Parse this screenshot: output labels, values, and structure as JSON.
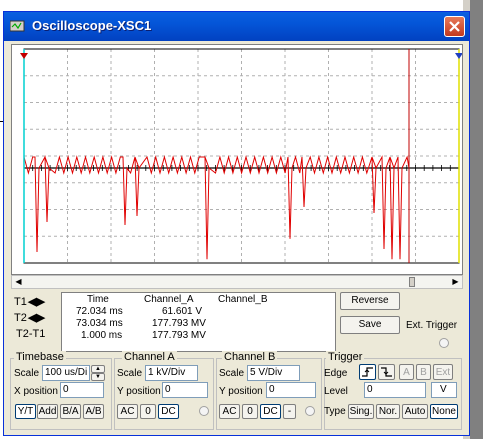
{
  "window": {
    "title": "Oscilloscope-XSC1"
  },
  "colors": {
    "trace_a": "#e00000",
    "cursor_t1": "#00d0d0",
    "cursor_t2": "#e0e000",
    "titlebar": "#0455d8"
  },
  "icons": {
    "title": "oscilloscope-icon",
    "close": "close-icon"
  },
  "readout": {
    "headers": [
      "Time",
      "Channel_A",
      "Channel_B"
    ],
    "rows": [
      {
        "label": "T1",
        "time": "72.034 ms",
        "a": "61.601 V",
        "b": ""
      },
      {
        "label": "T2",
        "time": "73.034 ms",
        "a": "177.793 MV",
        "b": ""
      },
      {
        "label": "T2-T1",
        "time": "1.000 ms",
        "a": "177.793 MV",
        "b": ""
      }
    ]
  },
  "buttons": {
    "reverse": "Reverse",
    "save": "Save"
  },
  "ext_trigger": "Ext. Trigger",
  "timebase": {
    "title": "Timebase",
    "scale_label": "Scale",
    "scale_value": "100 us/Di",
    "xpos_label": "X position",
    "xpos_value": "0",
    "modes": [
      "Y/T",
      "Add",
      "B/A",
      "A/B"
    ]
  },
  "channel_a": {
    "title": "Channel A",
    "scale_label": "Scale",
    "scale_value": "1 kV/Div",
    "ypos_label": "Y position",
    "ypos_value": "0",
    "coupling": [
      "AC",
      "0",
      "DC"
    ]
  },
  "channel_b": {
    "title": "Channel B",
    "scale_label": "Scale",
    "scale_value": "5  V/Div",
    "ypos_label": "Y position",
    "ypos_value": "0",
    "coupling": [
      "AC",
      "0",
      "DC",
      "-"
    ]
  },
  "trigger": {
    "title": "Trigger",
    "edge_label": "Edge",
    "sources": [
      "A",
      "B",
      "Ext"
    ],
    "level_label": "Level",
    "level_value": "0",
    "level_unit": "V",
    "type_label": "Type",
    "types": [
      "Sing.",
      "Nor.",
      "Auto",
      "None"
    ]
  }
}
